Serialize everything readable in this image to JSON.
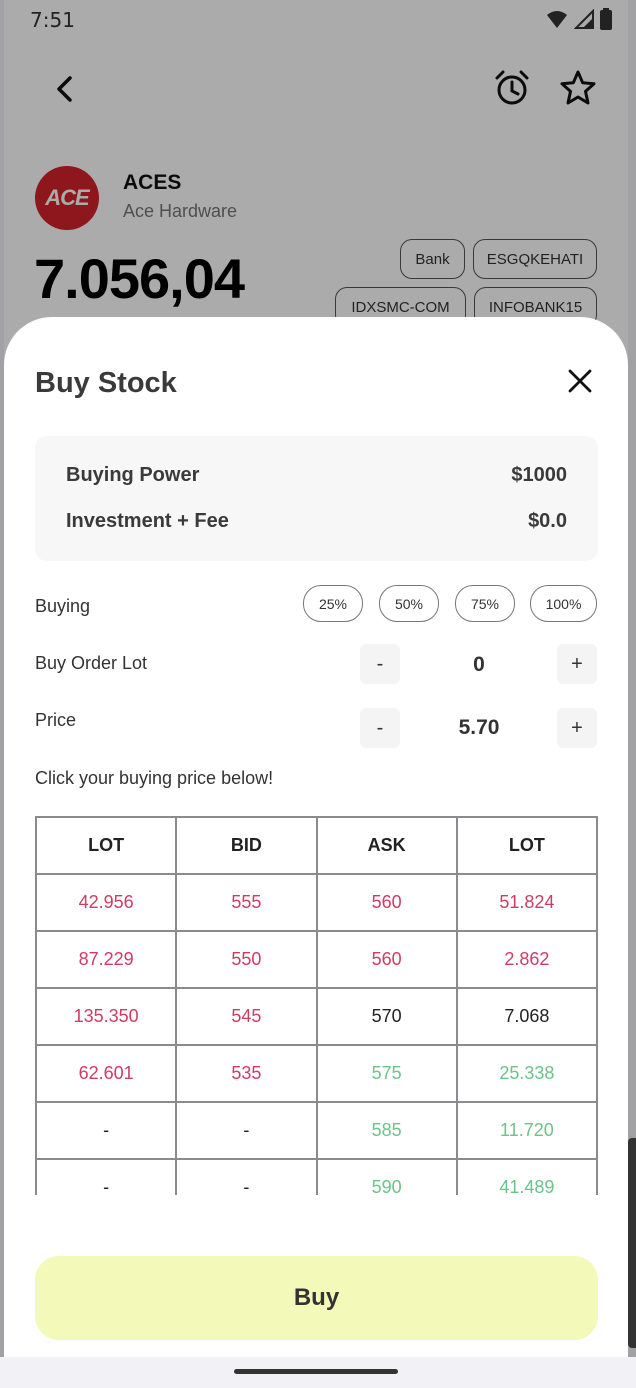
{
  "status_bar": {
    "time": "7:51"
  },
  "stock": {
    "logo_text": "ACE",
    "ticker": "ACES",
    "name": "Ace Hardware",
    "price": "7.056,04",
    "tags": [
      "Bank",
      "ESGQKEHATI",
      "IDXSMC-COM",
      "INFOBANK15"
    ]
  },
  "sheet": {
    "title": "Buy Stock",
    "buying_power_label": "Buying Power",
    "buying_power_value": "$1000",
    "investment_label": "Investment + Fee",
    "investment_value": "$0.0",
    "buying_label": "Buying",
    "percent_options": [
      "25%",
      "50%",
      "75%",
      "100%"
    ],
    "lot_label": "Buy Order Lot",
    "lot_value": "0",
    "price_label": "Price",
    "price_value": "5.70",
    "minus": "-",
    "plus": "+",
    "hint": "Click your buying price below!",
    "buy_label": "Buy"
  },
  "orderbook": {
    "headers": [
      "LOT",
      "BID",
      "ASK",
      "LOT"
    ],
    "rows": [
      [
        {
          "v": "42.956",
          "c": "red"
        },
        {
          "v": "555",
          "c": "red"
        },
        {
          "v": "560",
          "c": "red"
        },
        {
          "v": "51.824",
          "c": "red"
        }
      ],
      [
        {
          "v": "87.229",
          "c": "red"
        },
        {
          "v": "550",
          "c": "red"
        },
        {
          "v": "560",
          "c": "red"
        },
        {
          "v": "2.862",
          "c": "red"
        }
      ],
      [
        {
          "v": "135.350",
          "c": "red"
        },
        {
          "v": "545",
          "c": "red"
        },
        {
          "v": "570",
          "c": "neutral"
        },
        {
          "v": "7.068",
          "c": "neutral"
        }
      ],
      [
        {
          "v": "62.601",
          "c": "red"
        },
        {
          "v": "535",
          "c": "red"
        },
        {
          "v": "575",
          "c": "green"
        },
        {
          "v": "25.338",
          "c": "green"
        }
      ],
      [
        {
          "v": "-",
          "c": "neutral"
        },
        {
          "v": "-",
          "c": "neutral"
        },
        {
          "v": "585",
          "c": "green"
        },
        {
          "v": "11.720",
          "c": "green"
        }
      ],
      [
        {
          "v": "-",
          "c": "neutral"
        },
        {
          "v": "-",
          "c": "neutral"
        },
        {
          "v": "590",
          "c": "green"
        },
        {
          "v": "41.489",
          "c": "green"
        }
      ]
    ]
  },
  "colors": {
    "bid_red": "#d13b63",
    "ask_green": "#6cc38a",
    "buy_button_bg": "#f3f9b8",
    "logo_red": "#d2232a"
  },
  "icons": {
    "back": "chevron-left-icon",
    "alarm": "alarm-clock-icon",
    "favorite": "star-outline-icon",
    "close": "close-icon",
    "wifi": "wifi-icon",
    "signal": "cell-signal-icon",
    "battery": "battery-icon"
  }
}
